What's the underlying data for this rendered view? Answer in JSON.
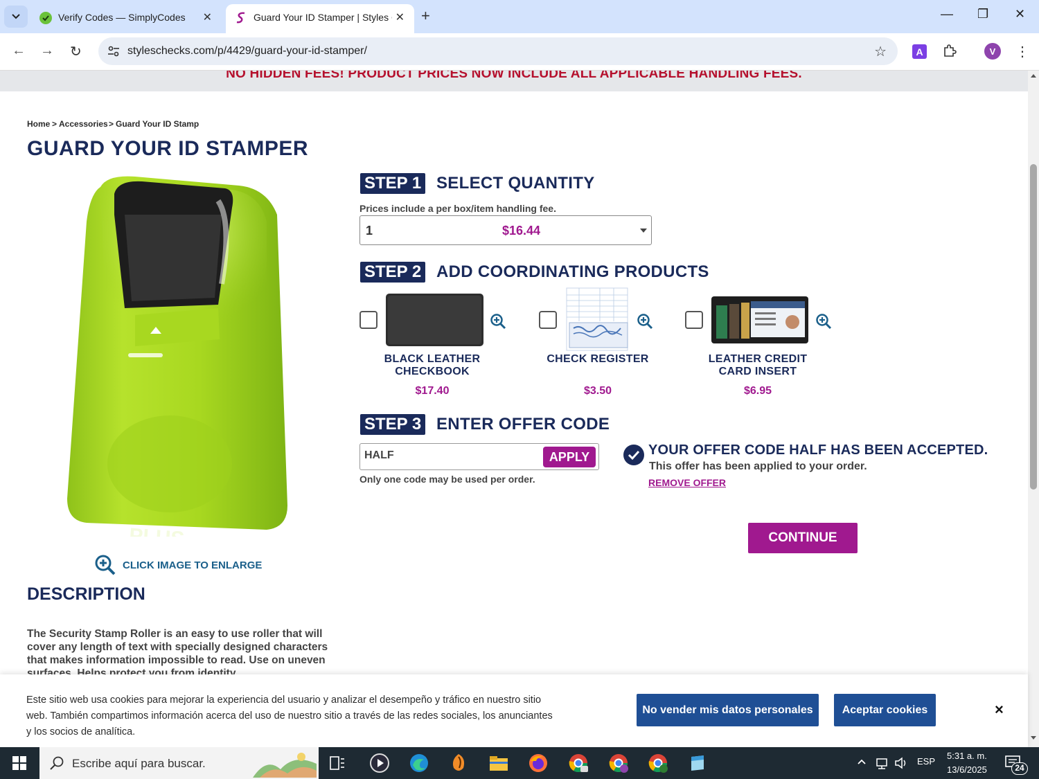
{
  "browser": {
    "tabs": [
      {
        "title": "Verify Codes — SimplyCodes",
        "active": false
      },
      {
        "title": "Guard Your ID Stamper | Styles C",
        "active": true
      }
    ],
    "url": "styleschecks.com/p/4429/guard-your-id-stamper/",
    "profile_initial": "V",
    "extension_letter": "A"
  },
  "page": {
    "banner": "NO HIDDEN FEES! PRODUCT PRICES NOW INCLUDE ALL APPLICABLE HANDLING FEES.",
    "breadcrumb": [
      "Home",
      ">",
      "Accessories",
      ">",
      "Guard Your ID Stamp"
    ],
    "title": "GUARD YOUR ID STAMPER",
    "product_brand": "PLUS",
    "enlarge_label": "CLICK IMAGE TO ENLARGE",
    "description_title": "DESCRIPTION",
    "description_text": "The Security Stamp Roller is an easy to use roller that will cover any length of text with specially designed characters that makes information impossible to read. Use on uneven surfaces. Helps protect you from identity",
    "step1": {
      "badge": "STEP 1",
      "title": "SELECT QUANTITY",
      "note": "Prices include a per box/item handling fee.",
      "quantity": "1",
      "price": "$16.44"
    },
    "step2": {
      "badge": "STEP 2",
      "title": "ADD COORDINATING PRODUCTS",
      "products": [
        {
          "name_line1": "BLACK LEATHER",
          "name_line2": "CHECKBOOK",
          "price": "$17.40",
          "checked": false
        },
        {
          "name_line1": "CHECK REGISTER",
          "name_line2": "",
          "price": "$3.50",
          "checked": false
        },
        {
          "name_line1": "LEATHER CREDIT",
          "name_line2": "CARD INSERT",
          "price": "$6.95",
          "checked": false
        }
      ]
    },
    "step3": {
      "badge": "STEP 3",
      "title": "ENTER OFFER CODE",
      "code_value": "HALF",
      "apply_label": "APPLY",
      "note": "Only one code may be used per order.",
      "accepted_title": "YOUR OFFER CODE HALF HAS BEEN ACCEPTED.",
      "accepted_sub": "This offer has been applied to your order.",
      "remove_label": "REMOVE OFFER"
    },
    "continue_label": "CONTINUE"
  },
  "cookie_bar": {
    "text": "Este sitio web usa cookies para mejorar la experiencia del usuario y analizar el desempeño y tráfico en nuestro sitio web. También compartimos información acerca del uso de nuestro sitio a través de las redes sociales, los anunciantes y los socios de analítica.",
    "no_sell_label": "No vender mis datos personales",
    "accept_label": "Aceptar cookies",
    "close_label": "×"
  },
  "taskbar": {
    "search_placeholder": "Escribe aquí para buscar.",
    "language": "ESP",
    "time": "5:31 a. m.",
    "date": "13/6/2025",
    "notifications": "24"
  },
  "colors": {
    "navy": "#1a2a5a",
    "magenta": "#a0198f",
    "banner_red": "#b5102d",
    "cookie_blue": "#1f4f95"
  }
}
